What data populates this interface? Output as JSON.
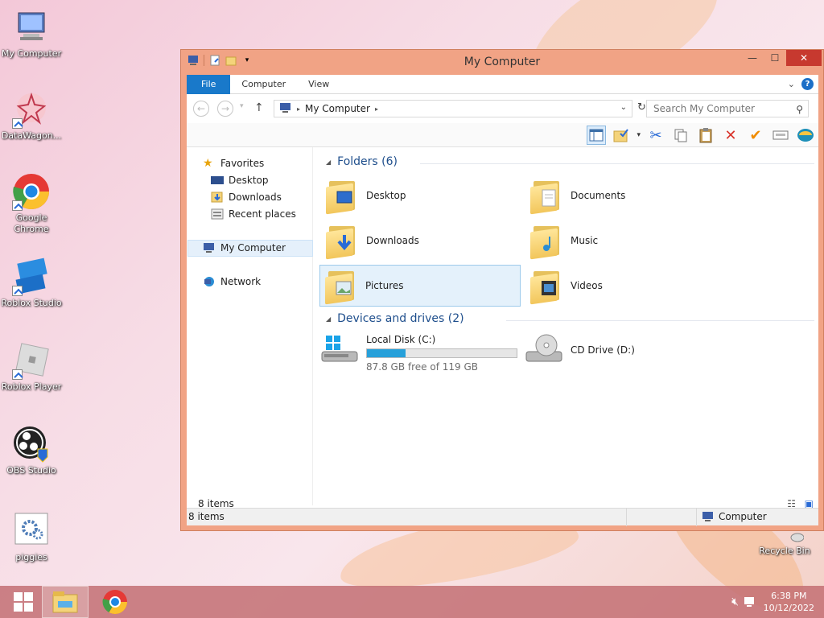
{
  "desktop": {
    "icons": [
      {
        "label": "My Computer"
      },
      {
        "label": "DataWagon..."
      },
      {
        "label": "Google Chrome"
      },
      {
        "label": "Roblox Studio"
      },
      {
        "label": "Roblox Player"
      },
      {
        "label": "OBS Studio"
      },
      {
        "label": "piggies"
      },
      {
        "label": "Recycle Bin"
      }
    ]
  },
  "window": {
    "title": "My Computer",
    "tabs": [
      {
        "label": "File"
      },
      {
        "label": "Computer"
      },
      {
        "label": "View"
      }
    ],
    "address": {
      "path": "My Computer"
    },
    "search": {
      "placeholder": "Search My Computer"
    },
    "nav": {
      "favorites": "Favorites",
      "desktop": "Desktop",
      "downloads": "Downloads",
      "recent": "Recent places",
      "my_computer": "My Computer",
      "network": "Network"
    },
    "folders_header": "Folders (6)",
    "folders": [
      {
        "name": "Desktop"
      },
      {
        "name": "Documents"
      },
      {
        "name": "Downloads"
      },
      {
        "name": "Music"
      },
      {
        "name": "Pictures"
      },
      {
        "name": "Videos"
      }
    ],
    "devices_header": "Devices and drives (2)",
    "drives": [
      {
        "name": "Local Disk (C:)",
        "free": "87.8 GB free of 119 GB",
        "used_fraction": 0.26
      },
      {
        "name": "CD Drive (D:)"
      }
    ],
    "item_count": "8 items",
    "status_left": "8 items",
    "status_right": "Computer"
  },
  "taskbar": {
    "time": "6:38 PM",
    "date": "10/12/2022"
  },
  "colors": {
    "accent": "#1979ca",
    "title_bar": "#f1a385",
    "close": "#c7392f",
    "drive_fill": "#26a0da"
  }
}
